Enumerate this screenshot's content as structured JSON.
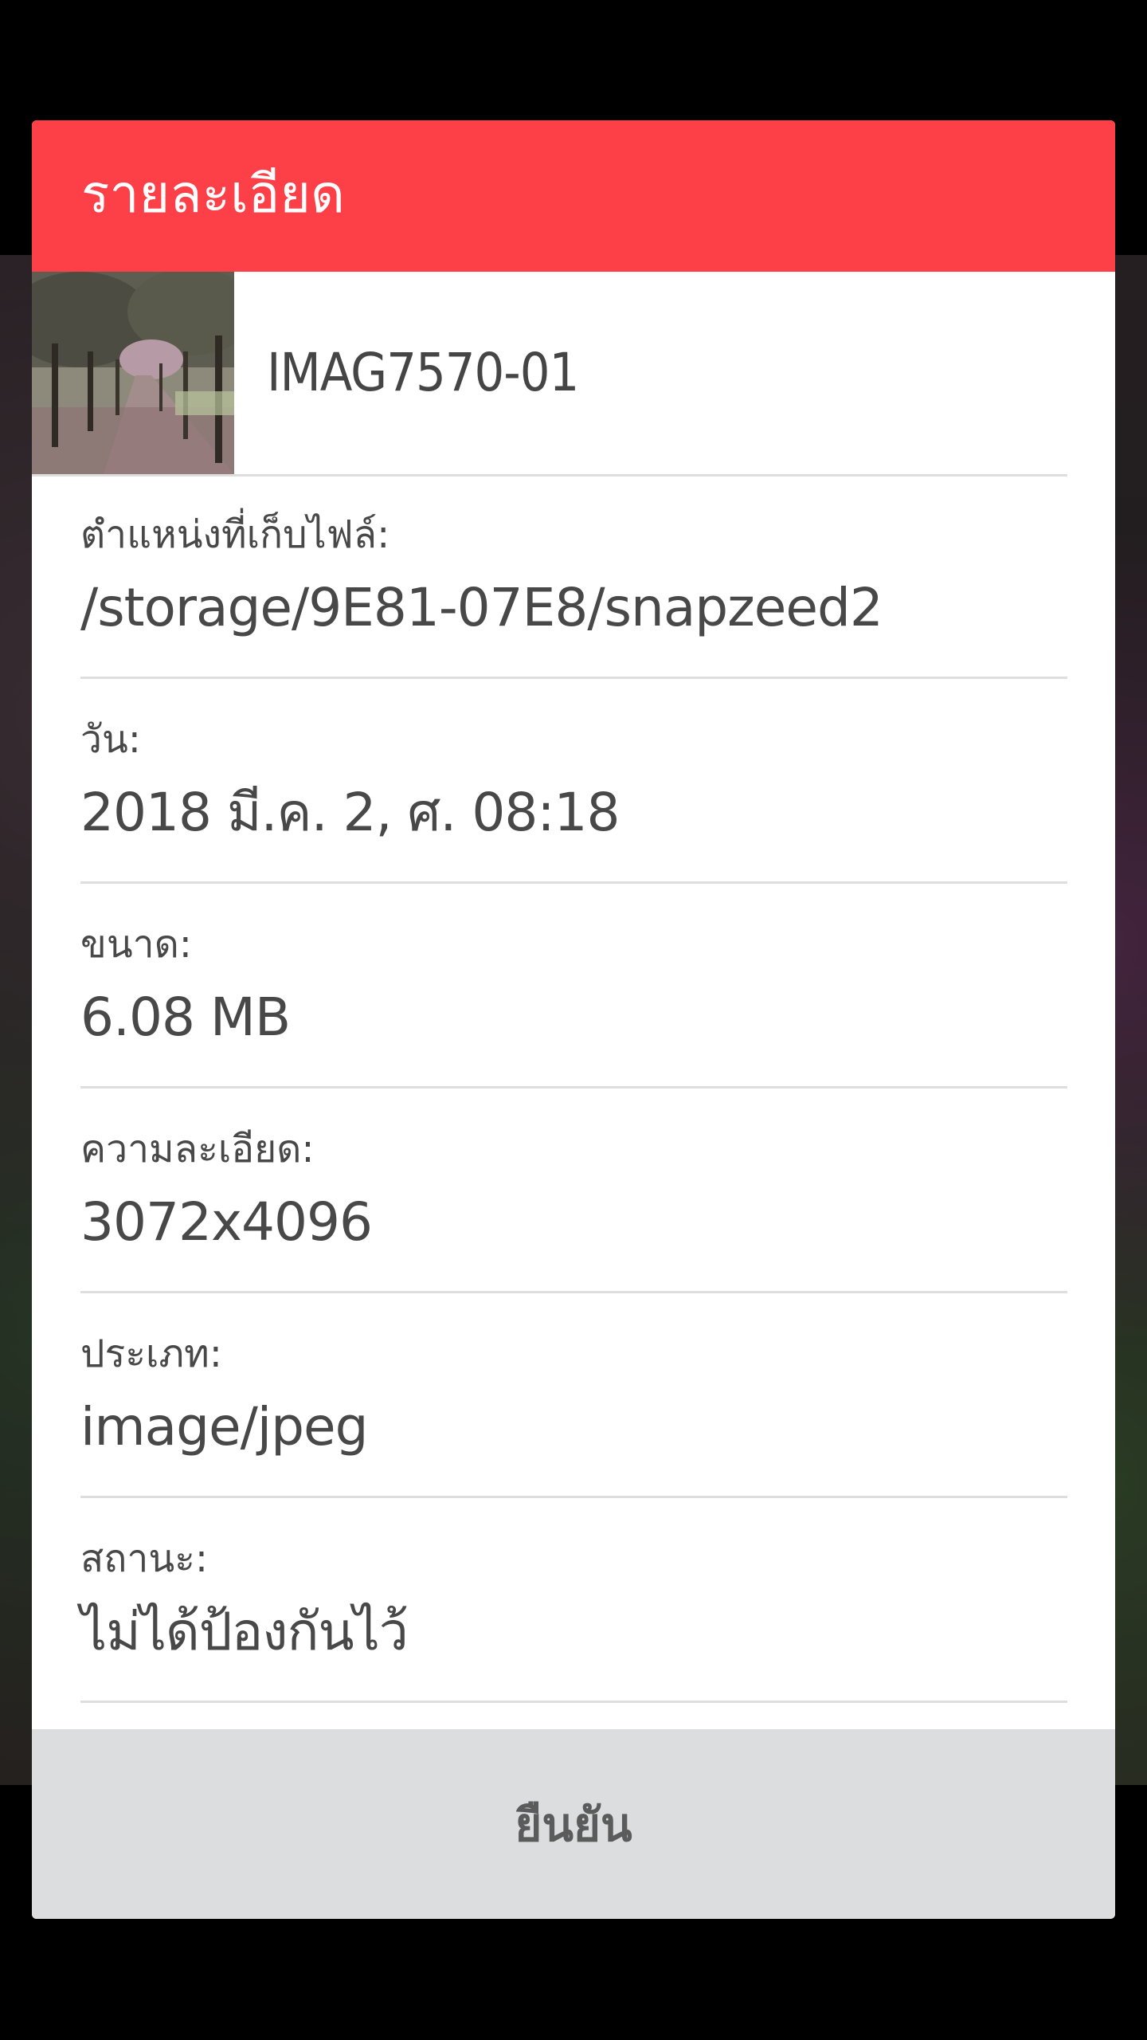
{
  "dialog": {
    "title": "รายละเอียด",
    "accent_color": "#fd3f47"
  },
  "file": {
    "name": "IMAG7570-01",
    "thumbnail_icon": "photo-thumbnail"
  },
  "details": [
    {
      "label": "ตำแหน่งที่เก็บไฟล์:",
      "value": "/storage/9E81-07E8/snapzeed2"
    },
    {
      "label": "วัน:",
      "value": "2018 มี.ค. 2, ศ. 08:18"
    },
    {
      "label": "ขนาด:",
      "value": "6.08 MB"
    },
    {
      "label": "ความละเอียด:",
      "value": "3072x4096"
    },
    {
      "label": "ประเภท:",
      "value": "image/jpeg"
    },
    {
      "label": "สถานะ:",
      "value": "ไม่ได้ป้องกันไว้"
    }
  ],
  "footer": {
    "confirm_label": "ยืนยัน"
  }
}
